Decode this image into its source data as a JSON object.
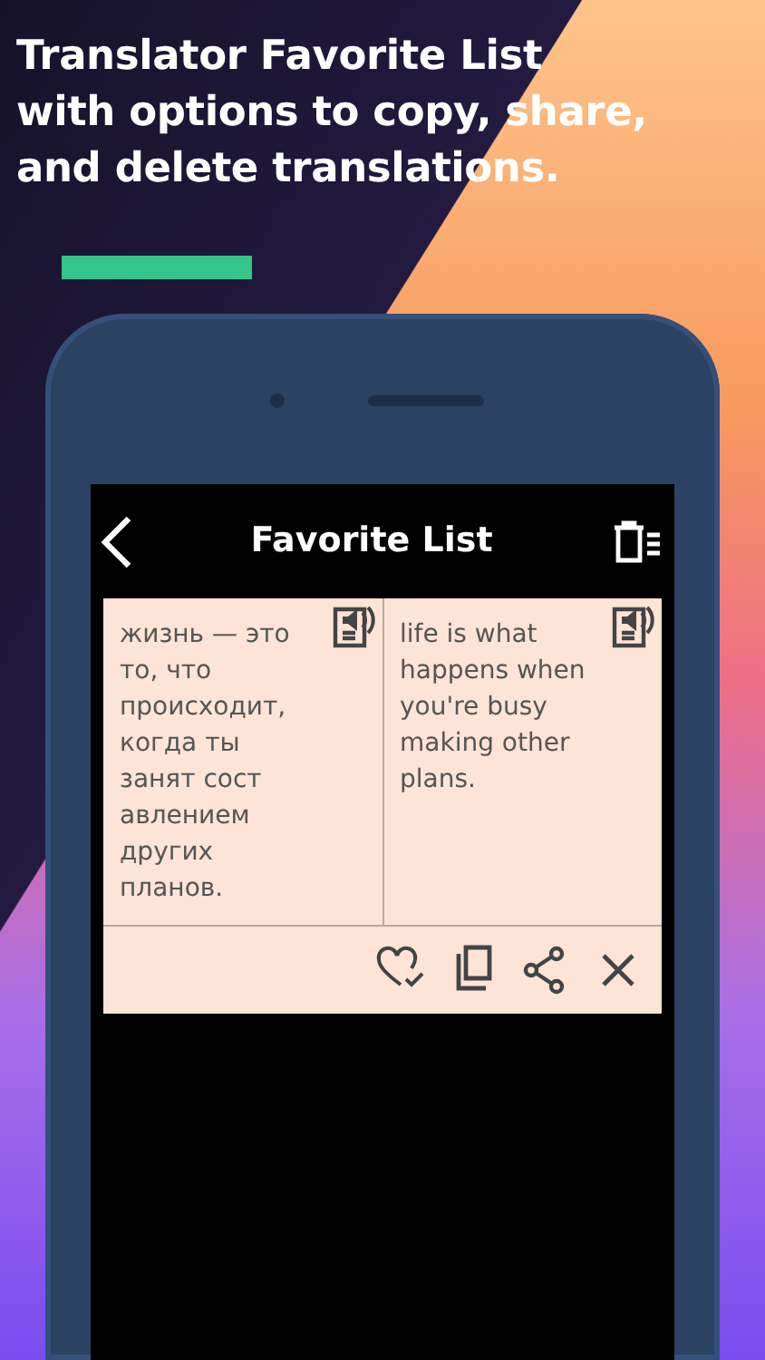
{
  "headline_lines": [
    "Translator Favorite List",
    "with options to copy, share,",
    "and delete translations."
  ],
  "screen": {
    "title": "Favorite List",
    "favorites": [
      {
        "source": "жизнь — это то, что происходит, когда ты занят сост авлением других планов.",
        "translation": "life is what happens when you're busy making other plans."
      }
    ]
  }
}
